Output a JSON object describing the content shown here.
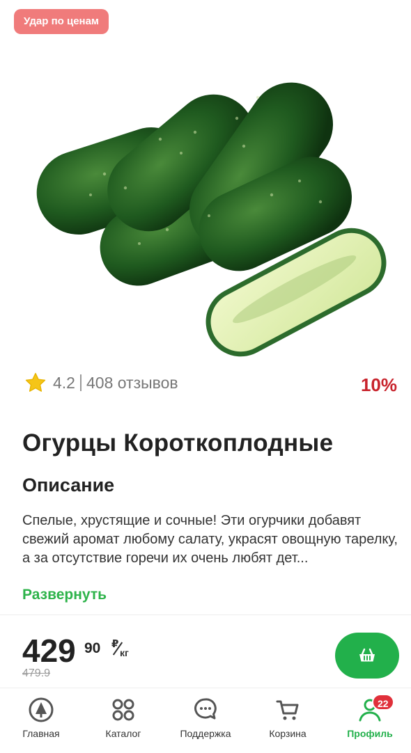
{
  "badge": {
    "label": "Удар по ценам"
  },
  "product": {
    "image": "cucumber-product-photo",
    "rating": "4.2",
    "reviews": "408 отзывов",
    "discount": "10%",
    "title": "Огурцы Короткоплодные"
  },
  "description": {
    "heading": "Описание",
    "text": "Спелые, хрустящие и сочные! Эти огурчики добавят свежий аромат любому салату, украсят овощную тарелку, а за отсутствие горечи их очень любят дет...",
    "expand_label": "Развернуть"
  },
  "price": {
    "main": "429",
    "cents": "90",
    "currency": "₽",
    "unit": "кг",
    "old": "479.9"
  },
  "cart_button": {
    "icon": "basket-icon"
  },
  "tabbar": {
    "tabs": [
      {
        "label": "Главная",
        "icon": "home-logo-icon"
      },
      {
        "label": "Каталог",
        "icon": "grid-icon"
      },
      {
        "label": "Поддержка",
        "icon": "support-chat-icon"
      },
      {
        "label": "Корзина",
        "icon": "cart-icon"
      },
      {
        "label": "Профиль",
        "icon": "profile-icon",
        "badge": "22",
        "active": true
      }
    ]
  },
  "colors": {
    "accent": "#22b04b",
    "discount": "#c8232c",
    "badge": "#f07b7b",
    "notif": "#e0303a"
  }
}
